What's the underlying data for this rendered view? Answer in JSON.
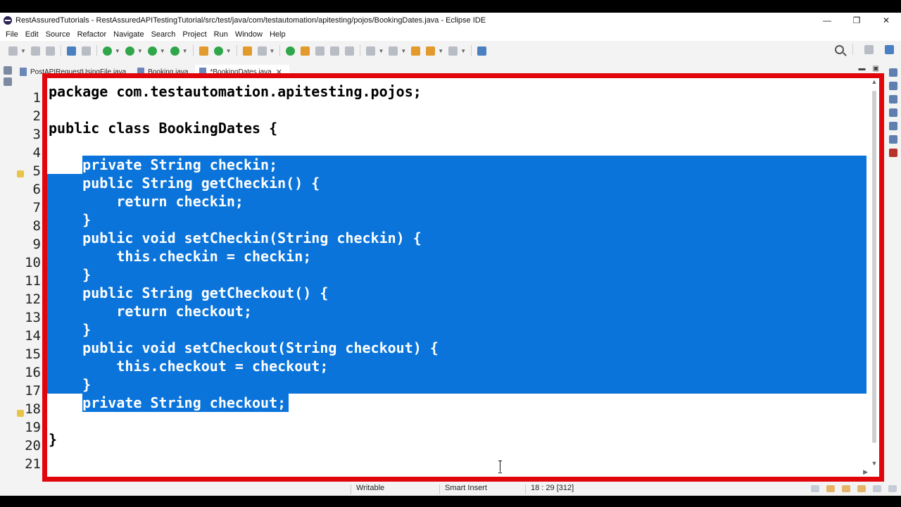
{
  "window": {
    "title": "RestAssuredTutorials - RestAssuredAPITestingTutorial/src/test/java/com/testautomation/apitesting/pojos/BookingDates.java - Eclipse IDE",
    "minimize": "—",
    "maximize": "❐",
    "close": "✕"
  },
  "menu": [
    "File",
    "Edit",
    "Source",
    "Refactor",
    "Navigate",
    "Search",
    "Project",
    "Run",
    "Window",
    "Help"
  ],
  "tabs": [
    {
      "label": "PostAPIRequestUsingFile.java"
    },
    {
      "label": "Booking.java"
    },
    {
      "label": "*BookingDates.java",
      "close": "✕"
    }
  ],
  "tab_controls": {
    "minimize": "▬",
    "maximize": "▣"
  },
  "editor": {
    "lines": [
      {
        "num": "1",
        "text": "package com.testautomation.apitesting.pojos;"
      },
      {
        "num": "2",
        "text": ""
      },
      {
        "num": "3",
        "text": "public class BookingDates {"
      },
      {
        "num": "4",
        "text": ""
      },
      {
        "num": "5",
        "text": "    private String checkin;"
      },
      {
        "num": "6",
        "text": "    public String getCheckin() {"
      },
      {
        "num": "7",
        "text": "        return checkin;"
      },
      {
        "num": "8",
        "text": "    }"
      },
      {
        "num": "9",
        "text": "    public void setCheckin(String checkin) {"
      },
      {
        "num": "10",
        "text": "        this.checkin = checkin;"
      },
      {
        "num": "11",
        "text": "    }"
      },
      {
        "num": "12",
        "text": "    public String getCheckout() {"
      },
      {
        "num": "13",
        "text": "        return checkout;"
      },
      {
        "num": "14",
        "text": "    }"
      },
      {
        "num": "15",
        "text": "    public void setCheckout(String checkout) {"
      },
      {
        "num": "16",
        "text": "        this.checkout = checkout;"
      },
      {
        "num": "17",
        "text": "    }"
      },
      {
        "num": "18",
        "text": "    private String checkout;"
      },
      {
        "num": "19",
        "text": ""
      },
      {
        "num": "20",
        "text": "}"
      },
      {
        "num": "21",
        "text": ""
      }
    ],
    "scroll_up": "▲",
    "scroll_down": "▼",
    "scroll_right": "▶"
  },
  "status": {
    "writable": "Writable",
    "insert_mode": "Smart Insert",
    "position": "18 : 29 [312]"
  },
  "colors": {
    "selection": "#0a74da",
    "highlight_border": "#e0060c"
  }
}
